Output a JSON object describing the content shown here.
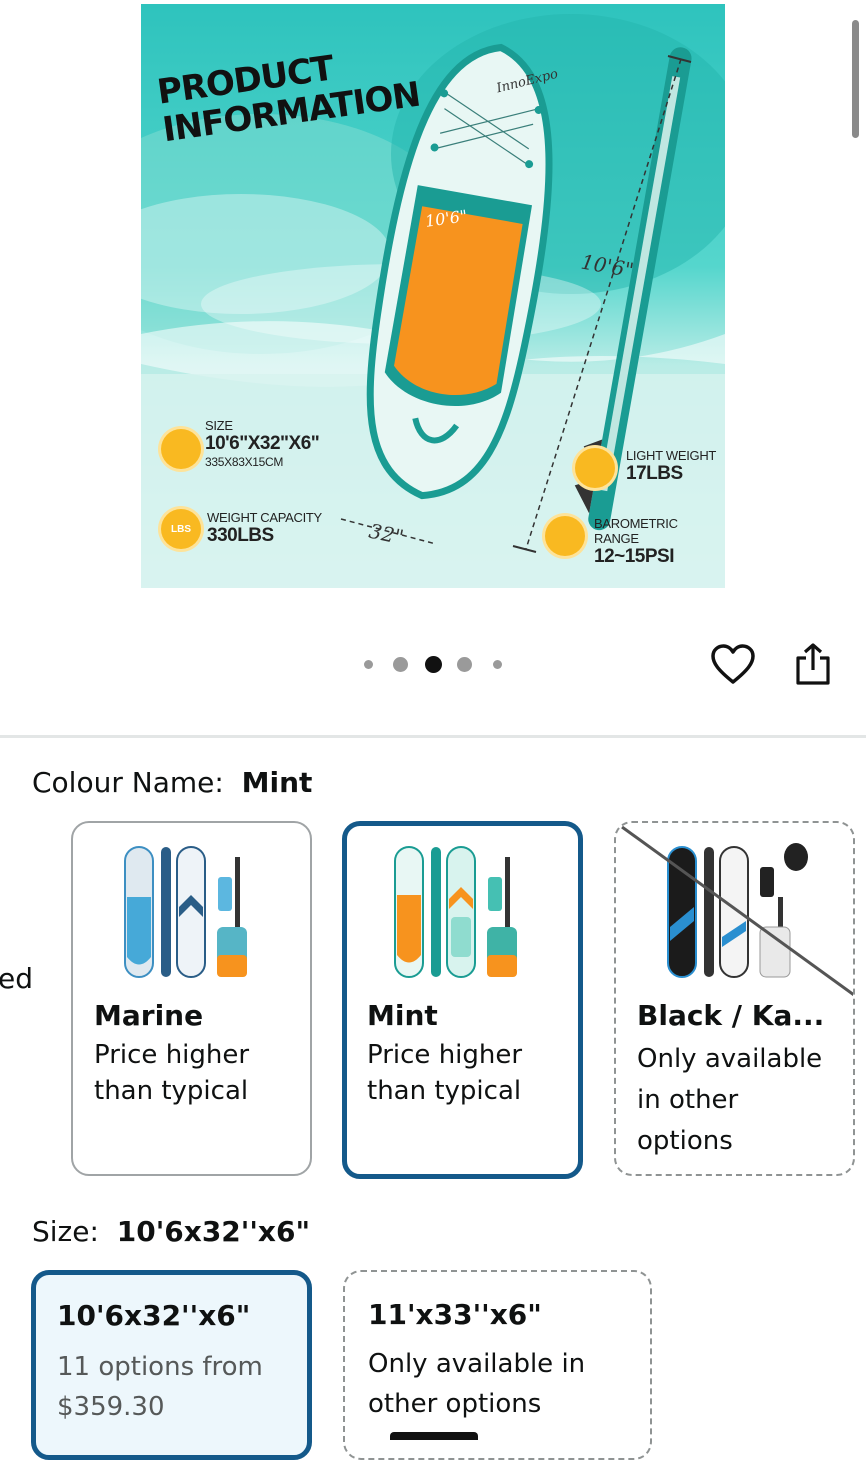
{
  "product_image": {
    "title_line1": "PRODUCT",
    "title_line2": "INFORMATION",
    "brand": "InnoExpo",
    "board_length_mark": "10'6\"",
    "length_dimension": "10'6\"",
    "width_dimension": "32\"",
    "side_print": "10'6\"x32\"x6\"",
    "specs": {
      "size_label": "SIZE",
      "size_value": "10'6\"X32\"X6\"",
      "size_metric": "335X83X15CM",
      "capacity_label": "WEIGHT CAPACITY",
      "capacity_value": "330LBS",
      "capacity_icon_text": "LBS",
      "weight_label": "LIGHT WEIGHT",
      "weight_value": "17LBS",
      "pressure_label": "BAROMETRIC RANGE",
      "pressure_value": "12~15PSI"
    },
    "colors": {
      "teal": "#1a9c93",
      "orange": "#f7931e",
      "icon_yellow": "#f9b921"
    }
  },
  "carousel": {
    "total_dots": 5,
    "active_index": 2
  },
  "actions": {
    "favorite_icon": "heart-icon",
    "share_icon": "share-icon"
  },
  "left_fragment": "ed",
  "colour": {
    "label": "Colour Name:",
    "selected": "Mint",
    "options": [
      {
        "name": "Marine",
        "note": "Price higher than typical",
        "note_line1": "Price higher",
        "note_line2": "than typical",
        "state": "available"
      },
      {
        "name": "Mint",
        "note": "Price higher than typical",
        "note_line1": "Price higher",
        "note_line2": "than typical",
        "state": "selected"
      },
      {
        "name": "Black / Ka...",
        "note_line1": "Only available",
        "note_line2": "in other",
        "note_line3": "options",
        "state": "unavailable"
      }
    ]
  },
  "size": {
    "label": "Size:",
    "selected": "10'6x32''x6\"",
    "options": [
      {
        "name": "10'6x32''x6\"",
        "line1": "11 options from",
        "line2": "$359.30",
        "state": "selected"
      },
      {
        "name": "11'x33''x6\"",
        "line1": "Only available in",
        "line2": "other options",
        "state": "unavailable"
      }
    ]
  },
  "accent_colors": {
    "selected_border": "#14598a",
    "selected_fill": "#edf7fc"
  }
}
